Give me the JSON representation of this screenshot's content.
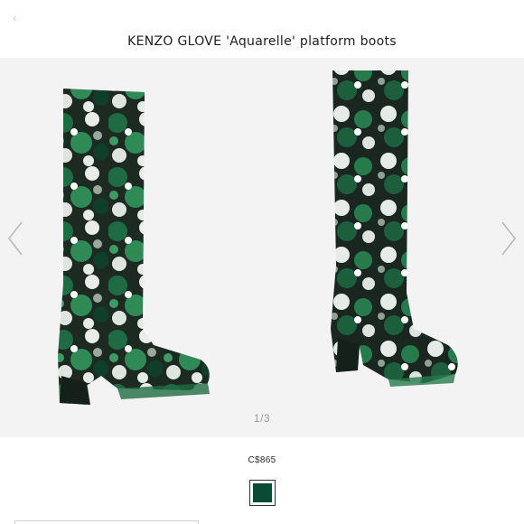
{
  "header": {
    "back_icon": "chevron-left-icon",
    "title": "KENZO GLOVE 'Aquarelle' platform boots"
  },
  "gallery": {
    "indicator": "1/3",
    "prev_icon": "chevron-left-icon",
    "next_icon": "chevron-right-icon"
  },
  "product": {
    "price": "C$865",
    "swatch_color": "#0b4a35"
  },
  "colors": {
    "gallery_bg": "#f3f3f3",
    "arrow": "#b8b8b8",
    "print_dark": "#1c2a22",
    "print_green": "#1f6b44",
    "print_light": "#e9ece8"
  }
}
